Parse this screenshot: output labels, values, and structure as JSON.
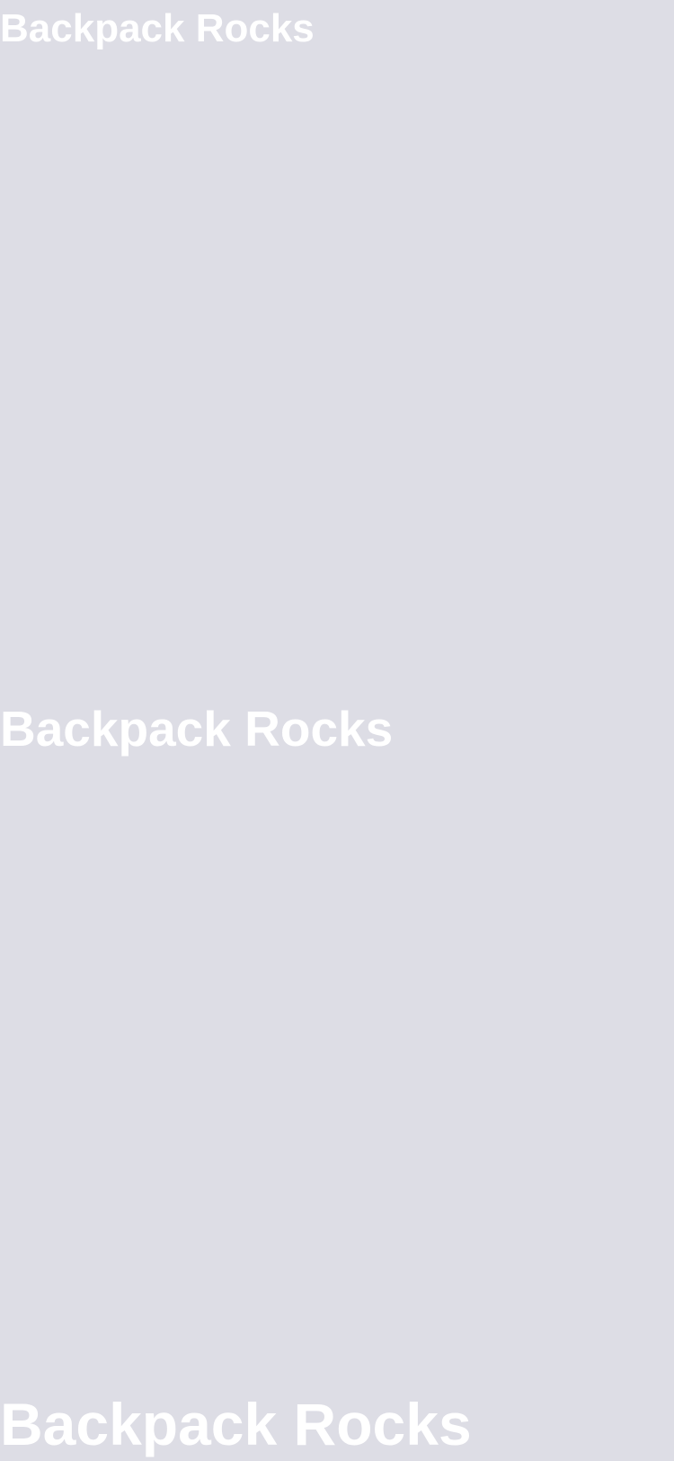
{
  "headings": {
    "small": "Backpack Rocks",
    "medium": "Backpack Rocks",
    "large": "Backpack Rocks"
  },
  "colors": {
    "background": "#dddde5",
    "text": "#ffffff"
  }
}
